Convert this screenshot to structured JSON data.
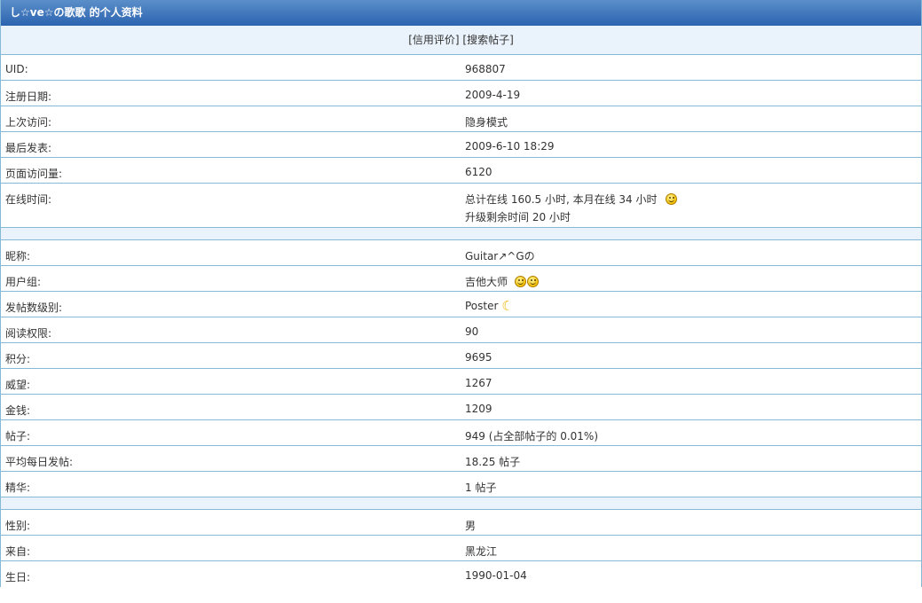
{
  "header": {
    "title": "し☆ve☆の歌歌 的个人资料"
  },
  "links": {
    "credit": "信用评价",
    "search_posts": "搜索帖子"
  },
  "section1": [
    {
      "label": "UID:",
      "value": "968807"
    },
    {
      "label": "注册日期:",
      "value": "2009-4-19"
    },
    {
      "label": "上次访问:",
      "value": "隐身模式"
    },
    {
      "label": "最后发表:",
      "value": "2009-6-10 18:29"
    },
    {
      "label": "页面访问量:",
      "value": "6120"
    }
  ],
  "online": {
    "label": "在线时间:",
    "line1": "总计在线  160.5 小时, 本月在线  34 小时",
    "line2": "升级剩余时间  20 小时",
    "icon": "smile-icon"
  },
  "section2": {
    "nickname": {
      "label": "昵称:",
      "value": "Guitar↗^Gの"
    },
    "usergroup": {
      "label": "用户组:",
      "value": "吉他大师",
      "icons": [
        "smile-icon",
        "smile-icon"
      ]
    },
    "post_level": {
      "label": "发帖数级别:",
      "value": "Poster",
      "icon": "moon-icon"
    },
    "rows": [
      {
        "label": "阅读权限:",
        "value": "90"
      },
      {
        "label": "积分:",
        "value": "9695"
      },
      {
        "label": "威望:",
        "value": "1267"
      },
      {
        "label": "金钱:",
        "value": "1209"
      },
      {
        "label": "帖子:",
        "value": "949 (占全部帖子的  0.01%)"
      },
      {
        "label": "平均每日发帖:",
        "value": "18.25 帖子"
      },
      {
        "label": "精华:",
        "value": "1 帖子"
      }
    ]
  },
  "section3": [
    {
      "label": "性别:",
      "value": "男"
    },
    {
      "label": "来自:",
      "value": "黑龙江"
    },
    {
      "label": "生日:",
      "value": "1990-01-04"
    }
  ]
}
